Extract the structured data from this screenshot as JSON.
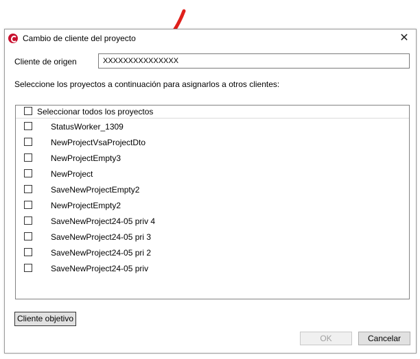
{
  "window": {
    "title": "Cambio de cliente del proyecto",
    "close_glyph": "✕"
  },
  "origin": {
    "label": "Cliente de origen",
    "value": "XXXXXXXXXXXXXXX"
  },
  "instructions": "Seleccione los proyectos a continuación para asignarlos a otros clientes:",
  "list": {
    "select_all_label": "Seleccionar todos los proyectos",
    "projects": [
      "StatusWorker_1309",
      "NewProjectVsaProjectDto",
      "NewProjectEmpty3",
      "NewProject",
      "SaveNewProjectEmpty2",
      "NewProjectEmpty2",
      "SaveNewProject24-05 priv 4",
      "SaveNewProject24-05 pri 3",
      "SaveNewProject24-05 pri 2",
      "SaveNewProject24-05 priv"
    ]
  },
  "buttons": {
    "target_client": "Cliente objetivo",
    "ok": "OK",
    "cancel": "Cancelar"
  },
  "colors": {
    "annotation_arrow": "#e0201b",
    "app_icon": "#c8102e"
  }
}
